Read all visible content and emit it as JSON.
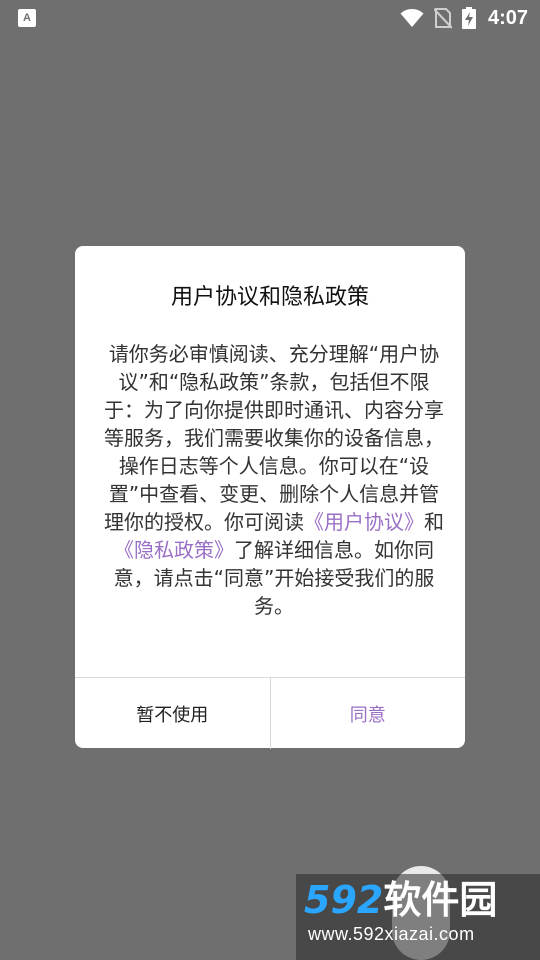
{
  "status_bar": {
    "app_icon_letter": "A",
    "time": "4:07",
    "icons": [
      "wifi-icon",
      "no-sim-icon",
      "battery-charging-icon"
    ]
  },
  "dialog": {
    "title": "用户协议和隐私政策",
    "body_part1": "请你务必审慎阅读、充分理解“用户协议”和“隐私政策”条款，包括但不限于：为了向你提供即时通讯、内容分享等服务，我们需要收集你的设备信息，操作日志等个人信息。你可以在“设置”中查看、变更、删除个人信息并管理你的授权。你可阅读",
    "link_user_agreement": "《用户协议》",
    "body_and": "和",
    "link_privacy_policy": "《隐私政策》",
    "body_part2": "了解详细信息。如你同意，请点击“同意”开始接受我们的服务。",
    "cancel_label": "暂不使用",
    "agree_label": "同意",
    "accent_color": "#9a6fc6"
  },
  "watermark": {
    "number": "592",
    "brand": "软件园",
    "url": "www.592xiazai.com"
  }
}
